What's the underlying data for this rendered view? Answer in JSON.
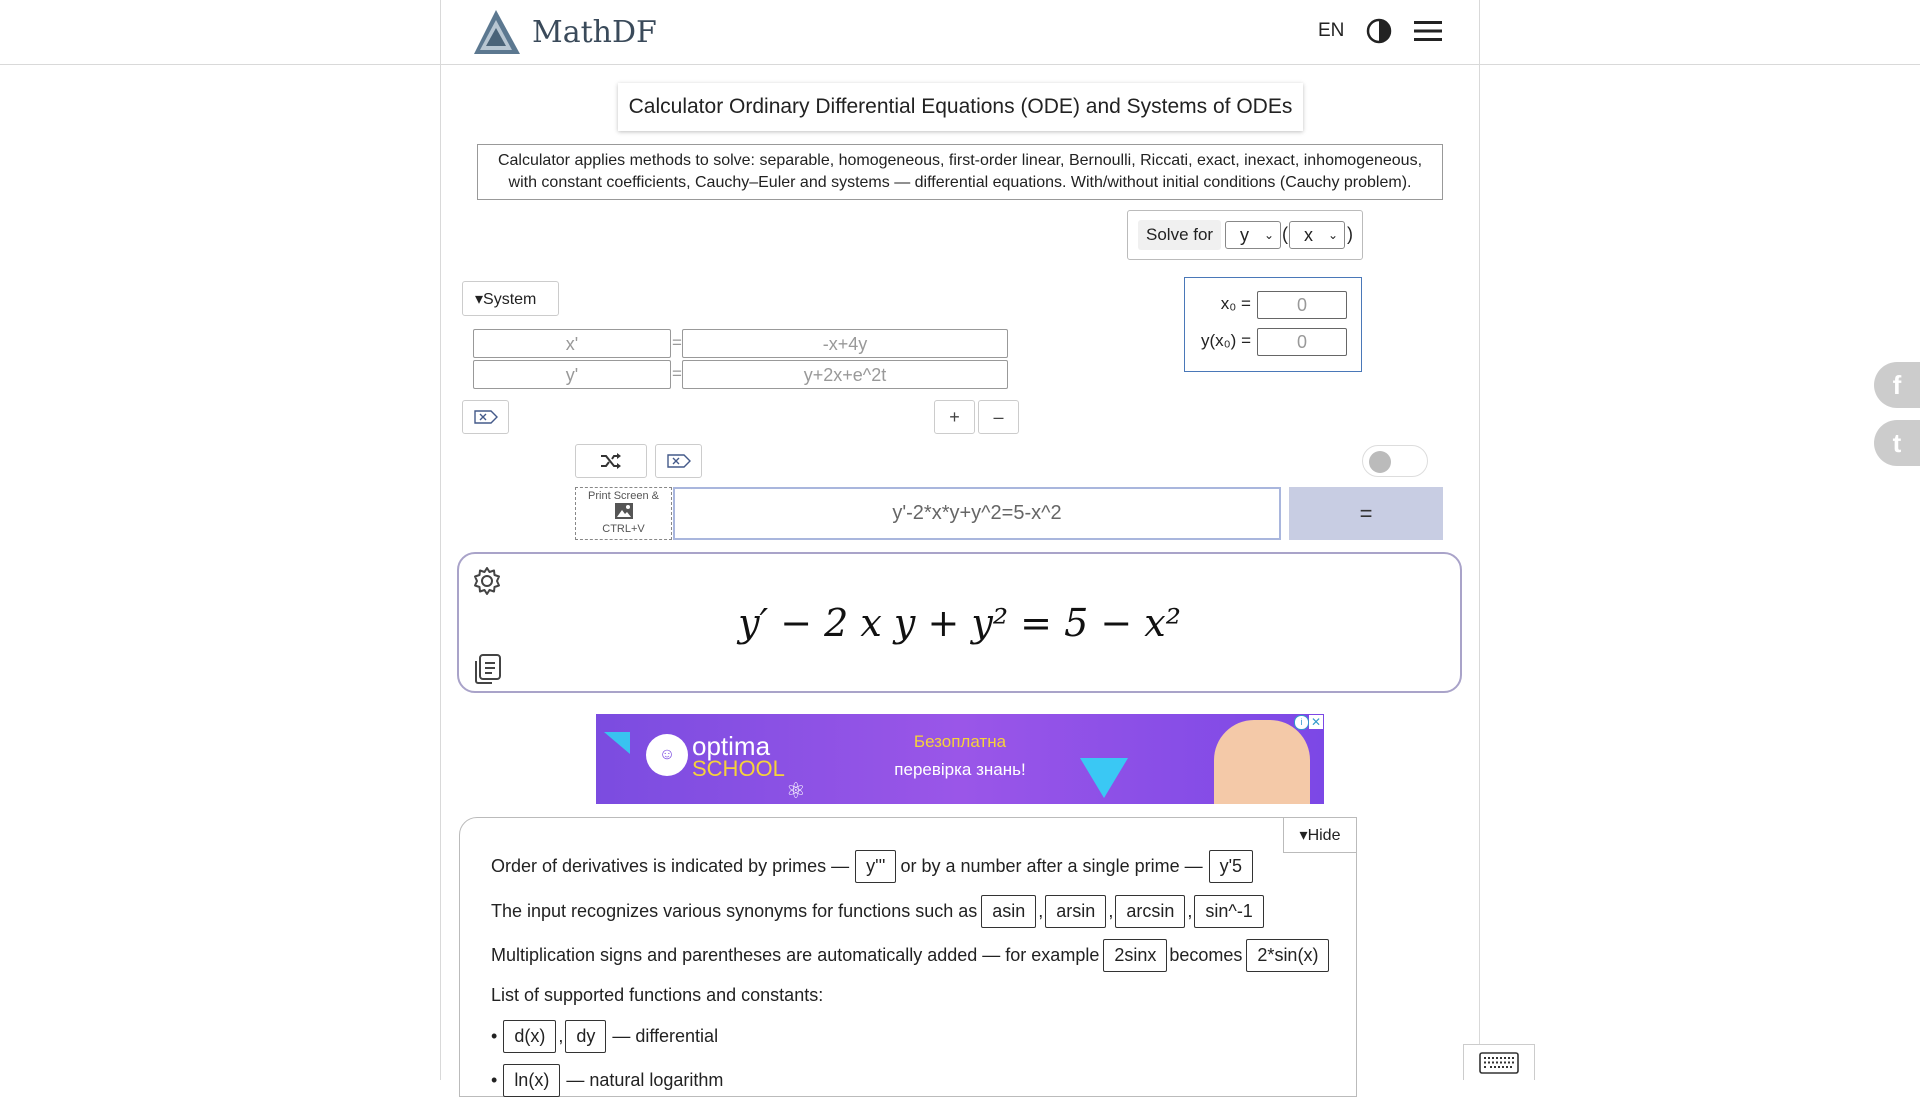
{
  "header": {
    "logo_text": "MathDF",
    "language": "EN"
  },
  "title": "Calculator Ordinary Differential Equations (ODE) and Systems of ODEs",
  "description_line1": "Calculator applies methods to solve: separable, homogeneous, first-order linear, Bernoulli, Riccati, exact, inexact, inhomogeneous,",
  "description_line2": "with constant coefficients, Cauchy–Euler and systems — differential equations. With/without initial conditions (Cauchy problem).",
  "solve_for": {
    "label": "Solve for",
    "function": "y",
    "open_paren": "(",
    "variable": "x",
    "close_paren": ")"
  },
  "initial_conditions": {
    "x0_label": "x₀ =",
    "x0_placeholder": "0",
    "yx0_label": "y(x₀) =",
    "yx0_placeholder": "0"
  },
  "system": {
    "toggle_label": "▾System",
    "equals": "=",
    "rows": [
      {
        "lhs_placeholder": "x'",
        "rhs_placeholder": "-x+4y"
      },
      {
        "lhs_placeholder": "y'",
        "rhs_placeholder": "y+2x+e^2t"
      }
    ],
    "add_label": "+",
    "remove_label": "–"
  },
  "input": {
    "paste_label_top": "Print Screen &",
    "paste_label_bottom": "CTRL+V",
    "expression": "y'-2*x*y+y^2=5-x^2",
    "solve_button": "="
  },
  "preview": {
    "rendered": "y′ − 2 x y + y² = 5 − x²"
  },
  "ad": {
    "brand_top": "optima",
    "brand_bottom": "SCHOOL",
    "text_line1": "Безоплатна",
    "text_line2": "перевірка знань!"
  },
  "help": {
    "hide_label": "▾Hide",
    "line1_text1": "Order of derivatives is indicated by primes —",
    "line1_chip1": "y'''",
    "line1_text2": "or by a number after a single prime —",
    "line1_chip2": "y'5",
    "line2_text": "The input recognizes various synonyms for functions such as",
    "line2_chips": [
      "asin",
      "arsin",
      "arcsin",
      "sin^-1"
    ],
    "line2_sep": ",",
    "line3_text1": "Multiplication signs and parentheses are automatically added — for example",
    "line3_chip1": "2sinx",
    "line3_text2": "becomes",
    "line3_chip2": "2*sin(x)",
    "line4_text": "List of supported functions and constants:",
    "bullet": "•",
    "item1_chip1": "d(x)",
    "item1_sep": ",",
    "item1_chip2": "dy",
    "item1_text": "— differential",
    "item2_chip": "ln(x)",
    "item2_text": "— natural logarithm"
  },
  "share": {
    "facebook": "f",
    "twitter": "t"
  }
}
